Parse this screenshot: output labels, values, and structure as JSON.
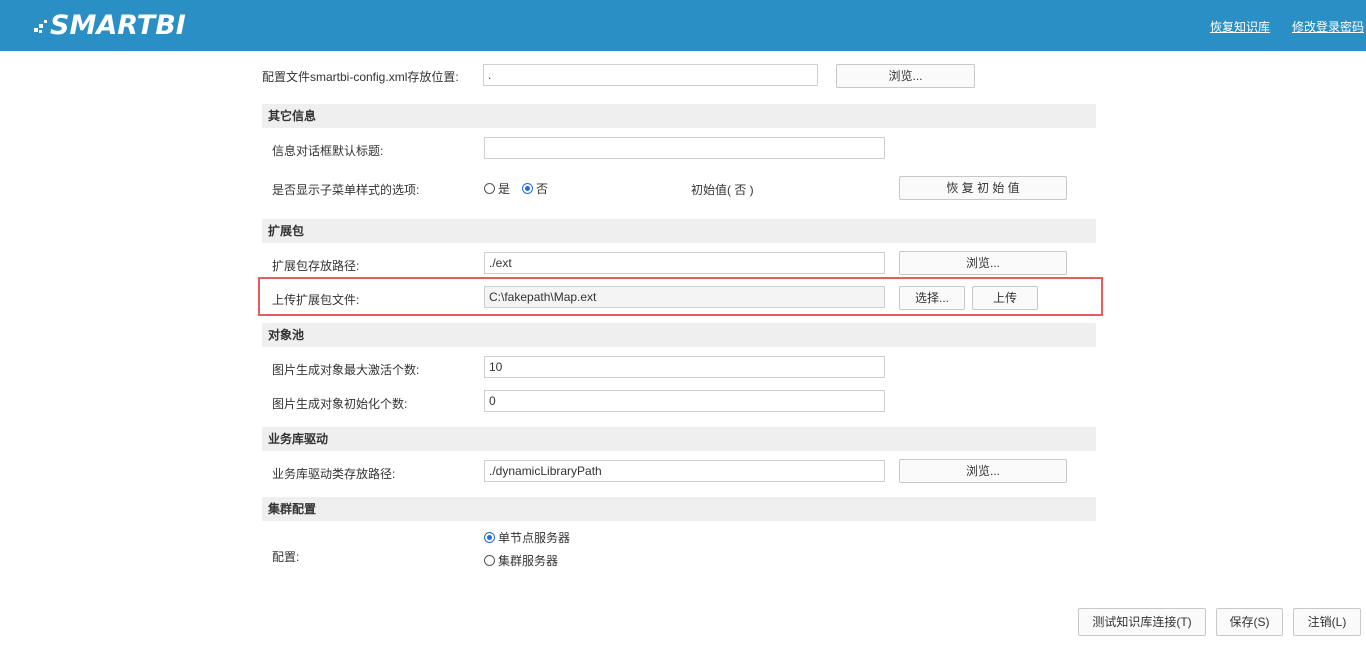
{
  "header": {
    "brand": "SMARTBI",
    "links": [
      "恢复知识库",
      "修改登录密码"
    ]
  },
  "config_file": {
    "label": "配置文件smartbi-config.xml存放位置:",
    "value": ".",
    "browse_label": "浏览..."
  },
  "other_info": {
    "title": "其它信息",
    "dialog_title_label": "信息对话框默认标题:",
    "dialog_title_value": "",
    "submenu_label": "是否显示子菜单样式的选项:",
    "option_yes": "是",
    "option_no": "否",
    "initial_value": "初始值( 否 )",
    "restore_label": "恢 复 初 始 值"
  },
  "extension": {
    "title": "扩展包",
    "path_label": "扩展包存放路径:",
    "path_value": "./ext",
    "browse_label": "浏览...",
    "upload_label": "上传扩展包文件:",
    "upload_value": "C:\\fakepath\\Map.ext",
    "choose_label": "选择...",
    "upload_button": "上传"
  },
  "object_pool": {
    "title": "对象池",
    "max_active_label": "图片生成对象最大激活个数:",
    "max_active_value": "10",
    "init_count_label": "图片生成对象初始化个数:",
    "init_count_value": "0"
  },
  "driver": {
    "title": "业务库驱动",
    "path_label": "业务库驱动类存放路径:",
    "path_value": "./dynamicLibraryPath",
    "browse_label": "浏览..."
  },
  "cluster": {
    "title": "集群配置",
    "config_label": "配置:",
    "option_single": "单节点服务器",
    "option_cluster": "集群服务器"
  },
  "footer": {
    "test_label": "测试知识库连接(T)",
    "save_label": "保存(S)",
    "logout_label": "注销(L)"
  },
  "colors": {
    "header_bg": "#2a8fc4",
    "highlight_border": "#e85c5c",
    "radio_checked": "#1e6fd9"
  }
}
